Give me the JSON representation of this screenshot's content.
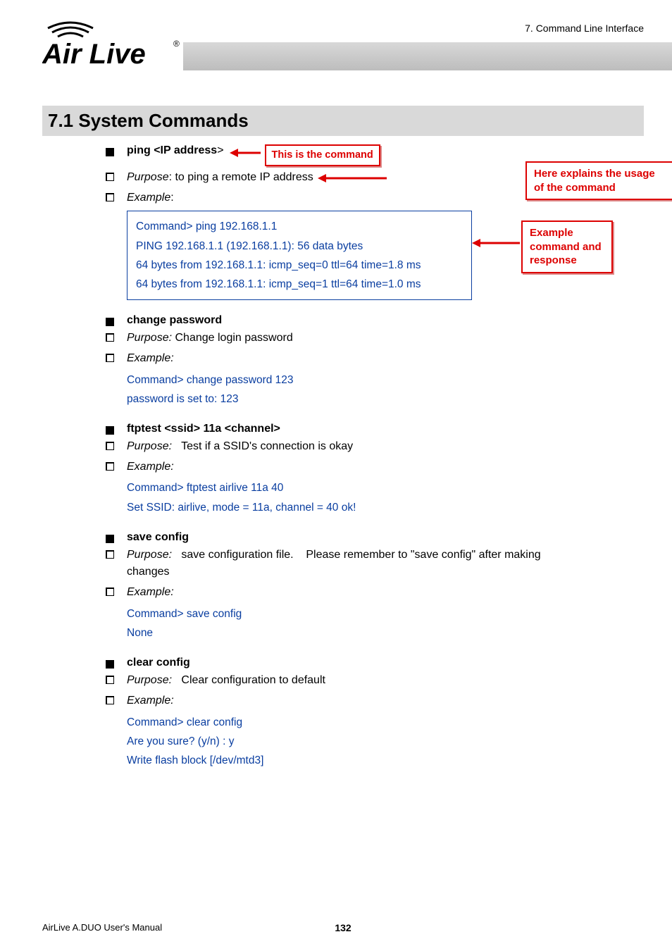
{
  "header": {
    "section_label": "7. Command Line Interface",
    "logo_text_main": "Air Live",
    "logo_reg": "®"
  },
  "title": "7.1 System  Commands",
  "callouts": {
    "this_is_cmd": "This is the command",
    "usage_l1": "Here explains the usage",
    "usage_l2": "of the command",
    "example_l1": "Example",
    "example_l2": "command and",
    "example_l3": "response"
  },
  "cmd_ping": {
    "title_pre": "ping <IP address",
    "title_post": ">",
    "purpose_label": "Purpose",
    "purpose_text": ": to ping a remote IP address",
    "example_label": "Example",
    "example_colon": ":",
    "code": [
      "Command> ping 192.168.1.1",
      "PING 192.168.1.1 (192.168.1.1): 56 data bytes",
      "64 bytes from 192.168.1.1: icmp_seq=0 ttl=64 time=1.8 ms",
      "64 bytes from 192.168.1.1: icmp_seq=1 ttl=64 time=1.0 ms"
    ]
  },
  "cmd_changepw": {
    "title": "change password",
    "purpose_label": "Purpose:",
    "purpose_text": " Change login password",
    "example_label": "Example:",
    "code": [
      "Command> change password 123",
      "password is set to: 123"
    ]
  },
  "cmd_ftptest": {
    "title": "ftptest <ssid> 11a <channel>",
    "purpose_label": "Purpose:",
    "purpose_text": "   Test if a SSID's connection is okay",
    "example_label": "Example:",
    "code": [
      "Command> ftptest airlive 11a 40",
      "Set SSID: airlive, mode = 11a, channel = 40 ok!"
    ]
  },
  "cmd_saveconfig": {
    "title": "save config",
    "purpose_label": "Purpose:",
    "purpose_text": "   save configuration file.    Please remember to \"save config\" after making changes",
    "example_label": "Example:",
    "code": [
      "Command> save config",
      "None"
    ]
  },
  "cmd_clearconfig": {
    "title": "clear config",
    "purpose_label": "Purpose:",
    "purpose_text": "   Clear configuration to default",
    "example_label": "Example:",
    "code": [
      "Command> clear config",
      "Are you sure? (y/n) : y",
      "Write flash block [/dev/mtd3]"
    ]
  },
  "footer": {
    "manual": "AirLive A.DUO User's Manual",
    "page": "132"
  }
}
